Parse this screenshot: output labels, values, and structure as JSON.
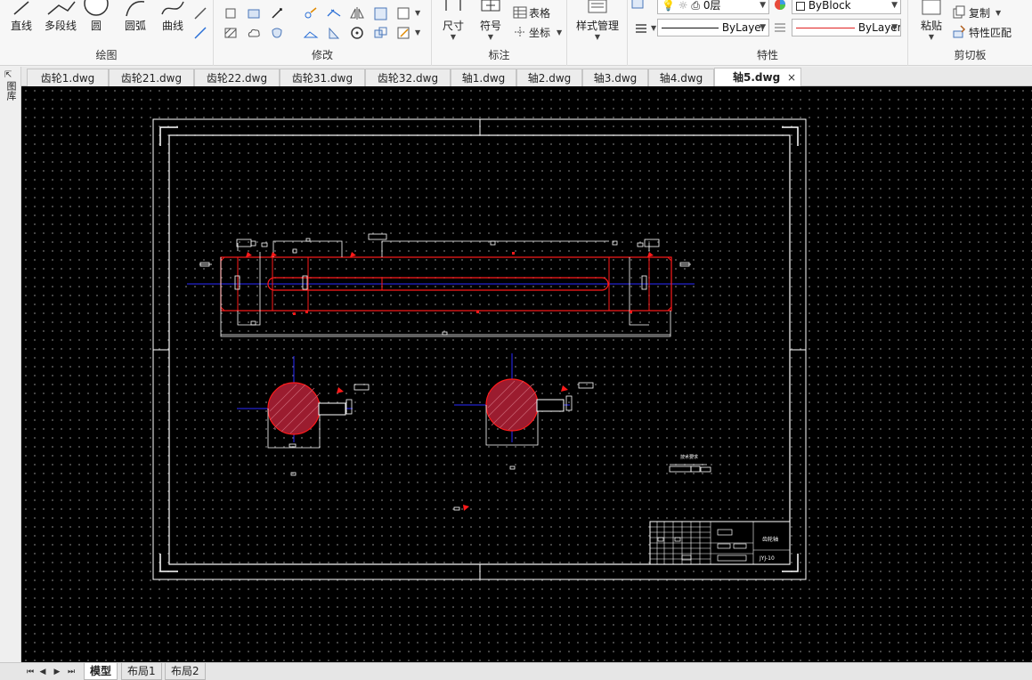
{
  "ribbon": {
    "draw_group": {
      "label": "绘图",
      "tools": [
        "直线",
        "多段线",
        "圆",
        "圆弧",
        "曲线"
      ]
    },
    "modify_group": {
      "label": "修改"
    },
    "annotate_group": {
      "label": "标注",
      "dimension": "尺寸",
      "symbol": "符号",
      "table": "表格",
      "coordinate": "坐标"
    },
    "style_group": {
      "label": "样式管理"
    },
    "properties_group": {
      "label": "特性",
      "layer_value": "0层",
      "color_value": "ByBlock",
      "linetype_value": "ByLayer",
      "lineweight_value": "ByLayer"
    },
    "clipboard_group": {
      "label": "剪切板",
      "paste": "粘贴",
      "copy": "复制",
      "match_prop": "特性匹配"
    }
  },
  "side_panel": {
    "label": "图库"
  },
  "tabs": [
    {
      "label": "齿轮1.dwg"
    },
    {
      "label": "齿轮21.dwg"
    },
    {
      "label": "齿轮22.dwg"
    },
    {
      "label": "齿轮31.dwg"
    },
    {
      "label": "齿轮32.dwg"
    },
    {
      "label": "轴1.dwg"
    },
    {
      "label": "轴2.dwg"
    },
    {
      "label": "轴3.dwg"
    },
    {
      "label": "轴4.dwg"
    },
    {
      "label": "轴5.dwg",
      "active": true
    }
  ],
  "tab_close": "×",
  "layout_tabs": [
    {
      "label": "模型",
      "active": true
    },
    {
      "label": "布局1"
    },
    {
      "label": "布局2"
    }
  ],
  "drawing": {
    "title_block_name": "齿轮轴",
    "title_block_code": "JYJ-10",
    "tech_req": "技术要求"
  },
  "colors": {
    "canvas_bg": "#000000",
    "outline": "#ffffff",
    "part": "#ff1a1a",
    "centerline": "#2a2aff"
  }
}
